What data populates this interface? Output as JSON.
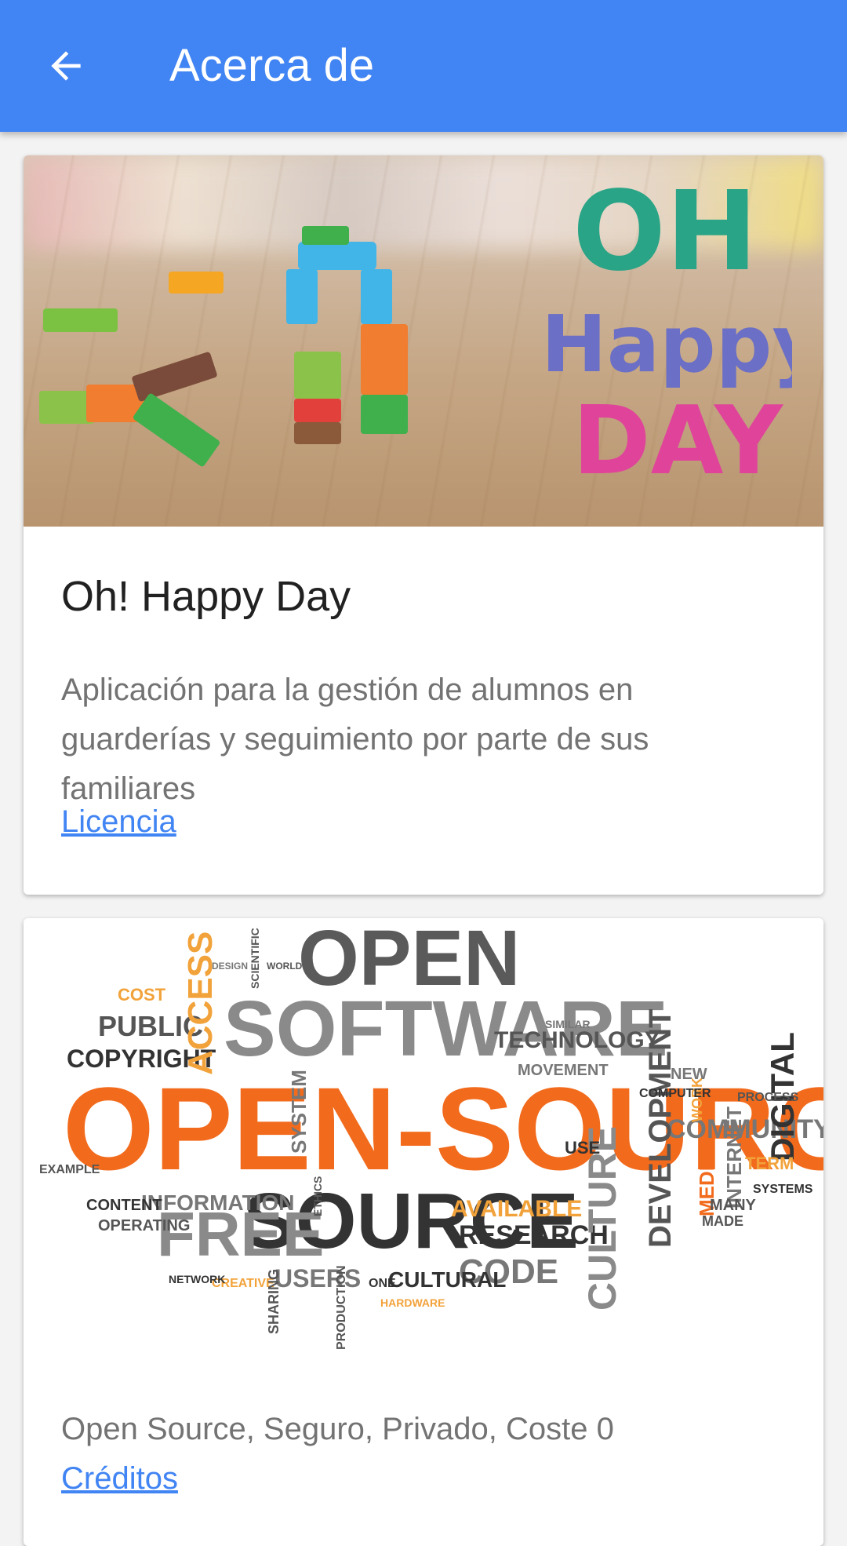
{
  "appbar": {
    "title": "Acerca de",
    "back_icon": "arrow-left-icon",
    "color": "#4184f3"
  },
  "app_card": {
    "image_text": {
      "line1": "OH",
      "line2": "Happy",
      "line3": "DAY!"
    },
    "title": "Oh! Happy Day",
    "description": "Aplicación para la gestión de alumnos en guarderías y seguimiento por parte de sus familiares",
    "license_link": "Licencia"
  },
  "oss_card": {
    "words": {
      "open": "OPEN",
      "software": "SOFTWARE",
      "open_source": "OPEN-SOURCE",
      "source": "SOURCE",
      "free": "FREE",
      "public": "PUBLIC",
      "copyright": "COPYRIGHT",
      "access": "ACCESS",
      "cost": "COST",
      "technology": "TECHNOLOGY",
      "movement": "MOVEMENT",
      "community": "COMMUNITY",
      "development": "DEVELOPMENT",
      "digital": "DIGITAL",
      "research": "RESEARCH",
      "code": "CODE",
      "culture": "CULTURE",
      "available": "AVAILABLE",
      "information": "INFORMATION",
      "content": "CONTENT",
      "operating": "OPERATING",
      "users": "USERS",
      "cultural": "CULTURAL",
      "system": "SYSTEM",
      "media": "MEDIA",
      "internet": "INTERNET",
      "use": "USE",
      "example": "EXAMPLE",
      "creative": "CREATIVE",
      "sharing": "SHARING",
      "production": "PRODUCTION",
      "work": "WORK",
      "term": "TERM",
      "many": "MANY",
      "made": "MADE",
      "process": "PROCESS",
      "computer": "COMPUTER",
      "new": "NEW",
      "one": "ONE",
      "network": "NETWORK",
      "hardware": "HARDWARE",
      "scientific": "SCIENTIFIC",
      "world": "WORLD",
      "design": "DESIGN",
      "similar": "SIMILAR",
      "systems": "SYSTEMS",
      "ethics": "ETHICS"
    },
    "description": "Open Source, Seguro, Privado, Coste 0",
    "credits_link": "Créditos"
  }
}
